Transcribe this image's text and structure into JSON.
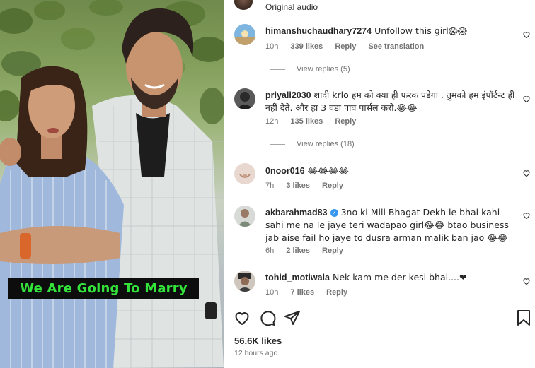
{
  "media": {
    "caption": "We Are Going To Marry"
  },
  "audio": {
    "label": "Original audio"
  },
  "comments": [
    {
      "username": "himanshuchaudhary7274",
      "text": "Unfollow this girl😱😱",
      "time": "10h",
      "likes": "339 likes",
      "reply": "Reply",
      "extra": "See translation",
      "view_replies": "View replies (5)"
    },
    {
      "username": "priyali2030",
      "text": "शादी krlo हम को क्या ही फरक पडेगा . तुमको हम इंपॉर्टन्ट ही नहीं देते. और हा 3 वडा पाव पार्सल करो.😂😂",
      "time": "12h",
      "likes": "135 likes",
      "reply": "Reply",
      "view_replies": "View replies (18)"
    },
    {
      "username": "0noor016",
      "text": "😂😂😂😂",
      "time": "7h",
      "likes": "3 likes",
      "reply": "Reply"
    },
    {
      "username": "akbarahmad83",
      "verified": true,
      "text": "3no ki Mili Bhagat Dekh le bhai kahi sahi me na le jaye teri wadapao girl😂😂 btao business jab aise fail ho jaye to dusra arman malik ban jao 😂😂",
      "time": "6h",
      "likes": "2 likes",
      "reply": "Reply"
    },
    {
      "username": "tohid_motiwala",
      "text": "Nek kam me der kesi bhai....❤",
      "time": "10h",
      "likes": "7 likes",
      "reply": "Reply"
    }
  ],
  "actions": {
    "like_icon": "heart-icon",
    "comment_icon": "comment-icon",
    "share_icon": "share-icon",
    "save_icon": "bookmark-icon"
  },
  "post": {
    "likes": "56.6K likes",
    "time_ago": "12 hours ago"
  },
  "colors": {
    "caption_text": "#33e23a",
    "caption_bg": "#0d0d0d",
    "verified": "#3897f0",
    "secondary_text": "#737373"
  }
}
